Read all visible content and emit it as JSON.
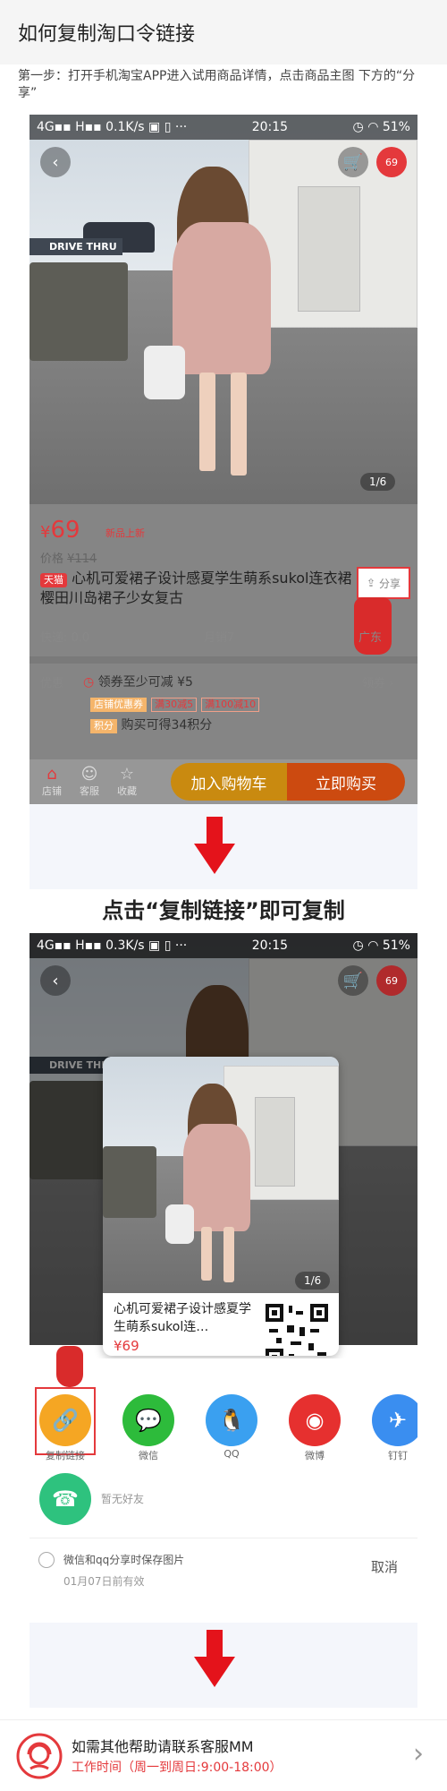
{
  "header": {
    "title": "如何复制淘口令链接"
  },
  "step1": {
    "text": "第一步：打开手机淘宝APP进入试用商品详情，点击商品主图 下方的“分享”"
  },
  "screen1": {
    "status": {
      "left": "4G▪▪ H▪▪ 0.1K/s ▣ ▯ ···",
      "time": "20:15",
      "right": "◷ ◠ 51%"
    },
    "cart_badge": "69",
    "sign_text": "DRIVE THRU",
    "image_counter": "1/6",
    "price_symbol": "¥",
    "price": "69",
    "new_tag": "新品上新",
    "old_price_label": "价格",
    "old_price": "¥114",
    "tmall_tag": "天猫",
    "title": "心机可爱裙子设计感夏学生萌系sukol连衣裙樱田川岛裙子少女复古",
    "share_label": "分享",
    "shipping": "快递: 0.0",
    "monthly_sales": "月销7",
    "location": "广东",
    "promo_label": "优惠",
    "coupon_text": "领券至少可减 ¥5",
    "claim_label": "领券",
    "shop_coupon_tag": "店铺优惠券",
    "coupon1": "满30减5",
    "coupon2": "满100减10",
    "points_tag": "积分",
    "points_text": "购买可得34积分",
    "nav_shop": "店铺",
    "nav_service": "客服",
    "nav_favorite": "收藏",
    "add_cart": "加入购物车",
    "buy_now": "立即购买"
  },
  "caption": {
    "text": "点击“复制链接”即可复制"
  },
  "screen2": {
    "status": {
      "left": "4G▪▪ H▪▪ 0.3K/s ▣ ▯ ···",
      "time": "20:15",
      "right": "◷ ◠ 51%"
    },
    "cart_badge": "69",
    "sign_text": "DRIVE THRU",
    "image_counter": "1/6",
    "card_title": "心机可爱裙子设计感夏学生萌系sukol连…",
    "card_price": "¥69",
    "share_targets": [
      {
        "label": "复制链接",
        "color": "#f5a623",
        "icon": "link-icon"
      },
      {
        "label": "微信",
        "color": "#2dbb3b",
        "icon": "wechat-icon"
      },
      {
        "label": "QQ",
        "color": "#3aa0f0",
        "icon": "qq-icon"
      },
      {
        "label": "微博",
        "color": "#e6302f",
        "icon": "weibo-icon"
      },
      {
        "label": "钉钉",
        "color": "#3a8ef0",
        "icon": "dingtalk-icon"
      }
    ],
    "friend_label": "暂无好友",
    "save_option": "微信和qq分享时保存图片",
    "valid_until": "01月07日前有效",
    "cancel": "取消"
  },
  "footer": {
    "help_text": "如需其他帮助请联系客服MM",
    "hours": "工作时间（周一到周日:9:00-18:00）",
    "chevron": "›"
  },
  "colors": {
    "accent": "#e4393c",
    "buy_orange": "#f39800",
    "cart_yellow": "#f7b500"
  }
}
